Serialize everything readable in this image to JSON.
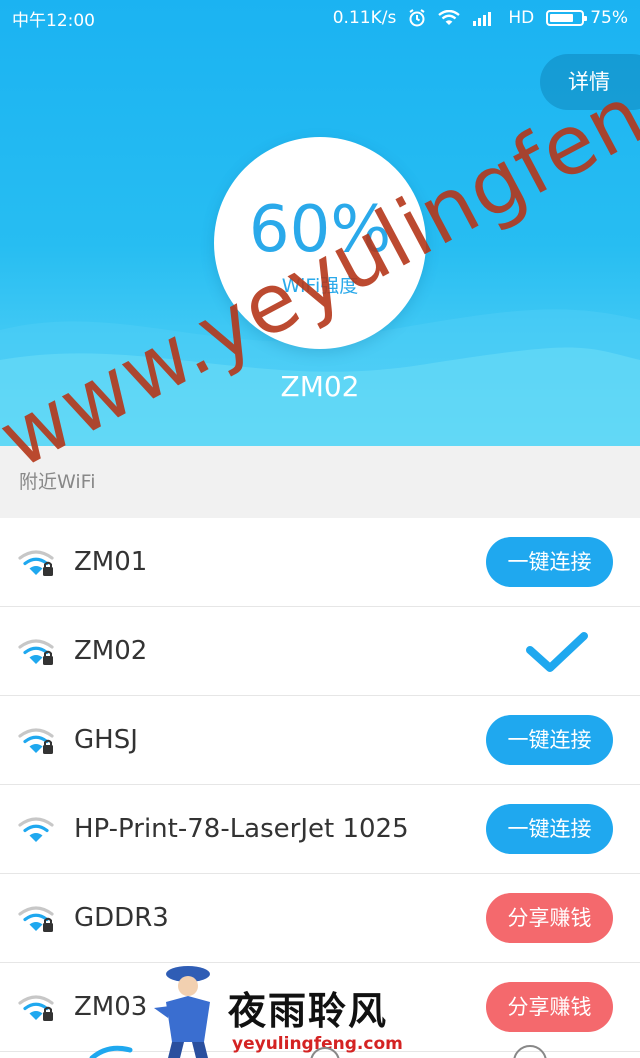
{
  "status_bar": {
    "time": "中午12:00",
    "speed": "0.11K/s",
    "network": "HD",
    "battery": "75%",
    "battery_level": 0.75,
    "icons": [
      "alarm-icon",
      "wifi-icon",
      "cell-signal-icon",
      "battery-icon"
    ]
  },
  "header": {
    "detail_button": "详情",
    "strength_value": "60%",
    "strength_label": "WiFi强度",
    "current_ssid": "ZM02"
  },
  "nearby": {
    "section_title": "附近WiFi",
    "networks": [
      {
        "ssid": "ZM01",
        "secured": true,
        "action": "一键连接",
        "action_type": "connect"
      },
      {
        "ssid": "ZM02",
        "secured": true,
        "action": "",
        "action_type": "connected"
      },
      {
        "ssid": "GHSJ",
        "secured": true,
        "action": "一键连接",
        "action_type": "connect"
      },
      {
        "ssid": "HP-Print-78-LaserJet 1025",
        "secured": false,
        "action": "一键连接",
        "action_type": "connect"
      },
      {
        "ssid": "GDDR3",
        "secured": true,
        "action": "分享赚钱",
        "action_type": "share"
      },
      {
        "ssid": "ZM03",
        "secured": true,
        "action": "分享赚钱",
        "action_type": "share"
      }
    ]
  },
  "watermark": {
    "diagonal_text": "www.yeyulingfeng.com",
    "logo_cn": "夜雨聆风",
    "logo_url": "yeyulingfeng.com"
  },
  "colors": {
    "accent_blue": "#1fa8ef",
    "share_red": "#f4696d",
    "watermark_red": "#b5371a"
  }
}
